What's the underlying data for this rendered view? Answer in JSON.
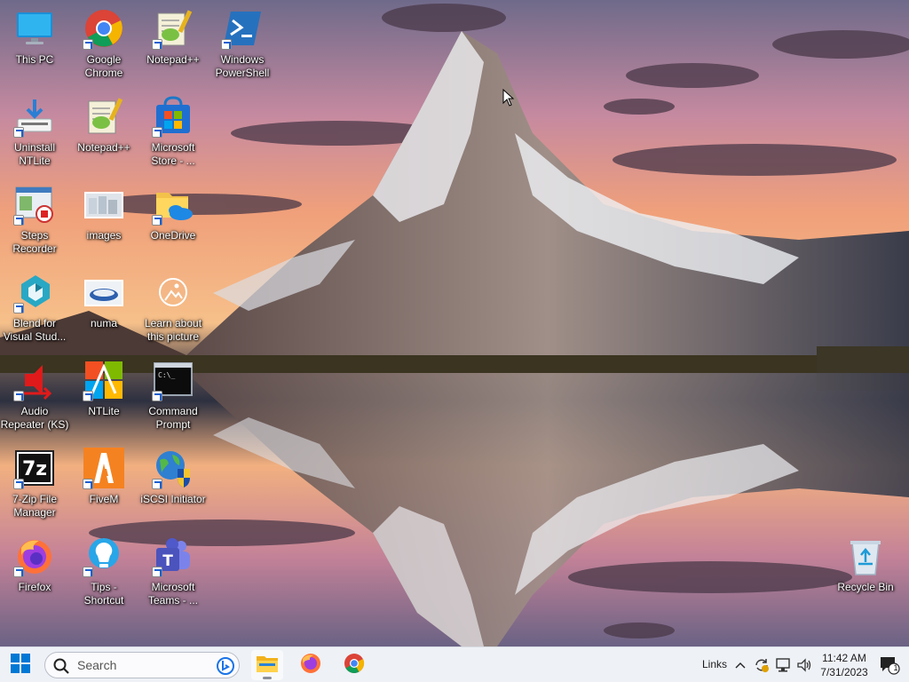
{
  "desktop": {
    "icons": [
      {
        "id": "this-pc",
        "label": "This PC",
        "icon": "monitor-icon",
        "shortcut": false
      },
      {
        "id": "google-chrome",
        "label": "Google\nChrome",
        "icon": "chrome-icon",
        "shortcut": true
      },
      {
        "id": "notepadpp-1",
        "label": "Notepad++",
        "icon": "notepad-plus-plus-icon",
        "shortcut": true
      },
      {
        "id": "windows-powershell",
        "label": "Windows\nPowerShell",
        "icon": "powershell-icon",
        "shortcut": true
      },
      {
        "id": "uninstall-ntlite",
        "label": "Uninstall\nNTLite",
        "icon": "uninstall-icon",
        "shortcut": true
      },
      {
        "id": "notepadpp-2",
        "label": "Notepad++",
        "icon": "notepad-plus-plus-icon",
        "shortcut": false
      },
      {
        "id": "microsoft-store",
        "label": "Microsoft\nStore - ...",
        "icon": "microsoft-store-icon",
        "shortcut": true
      },
      {
        "id": "steps-recorder",
        "label": "Steps\nRecorder",
        "icon": "steps-recorder-icon",
        "shortcut": true
      },
      {
        "id": "images",
        "label": "images",
        "icon": "image-thumbnail-icon",
        "shortcut": false
      },
      {
        "id": "onedrive",
        "label": "OneDrive",
        "icon": "onedrive-folder-icon",
        "shortcut": true
      },
      {
        "id": "blend",
        "label": "Blend for\nVisual Stud...",
        "icon": "blend-icon",
        "shortcut": true
      },
      {
        "id": "numa",
        "label": "numa",
        "icon": "image-thumbnail-icon",
        "shortcut": false
      },
      {
        "id": "learn-picture",
        "label": "Learn about\nthis picture",
        "icon": "camera-circle-icon",
        "shortcut": false
      },
      {
        "id": "audio-repeater",
        "label": "Audio\nRepeater (KS)",
        "icon": "speaker-red-icon",
        "shortcut": true
      },
      {
        "id": "ntlite",
        "label": "NTLite",
        "icon": "ntlite-icon",
        "shortcut": true
      },
      {
        "id": "command-prompt",
        "label": "Command\nPrompt",
        "icon": "terminal-icon",
        "shortcut": true
      },
      {
        "id": "7zip",
        "label": "7-Zip File\nManager",
        "icon": "7zip-icon",
        "shortcut": true
      },
      {
        "id": "fivem",
        "label": "FiveM",
        "icon": "fivem-icon",
        "shortcut": true
      },
      {
        "id": "iscsi",
        "label": "iSCSI Initiator",
        "icon": "globe-shield-icon",
        "shortcut": true
      },
      {
        "id": "firefox",
        "label": "Firefox",
        "icon": "firefox-icon",
        "shortcut": true
      },
      {
        "id": "tips",
        "label": "Tips -\nShortcut",
        "icon": "lightbulb-icon",
        "shortcut": true
      },
      {
        "id": "teams",
        "label": "Microsoft\nTeams - ...",
        "icon": "teams-icon",
        "shortcut": true
      },
      {
        "id": "recycle-bin",
        "label": "Recycle Bin",
        "icon": "recycle-bin-icon",
        "shortcut": false
      }
    ]
  },
  "taskbar": {
    "search_placeholder": "Search",
    "links_label": "Links",
    "time": "11:42 AM",
    "date": "7/31/2023",
    "notification_count": "1",
    "apps": [
      {
        "name": "File Explorer",
        "icon": "file-explorer-icon",
        "active": true
      },
      {
        "name": "Firefox",
        "icon": "firefox-icon",
        "active": false
      },
      {
        "name": "Google Chrome",
        "icon": "chrome-icon",
        "active": false
      }
    ]
  },
  "colors": {
    "taskbar_bg": "#eef1f6",
    "accent_blue": "#0067c0",
    "sky_top": "#7b7290",
    "sky_glow": "#f2a070"
  }
}
